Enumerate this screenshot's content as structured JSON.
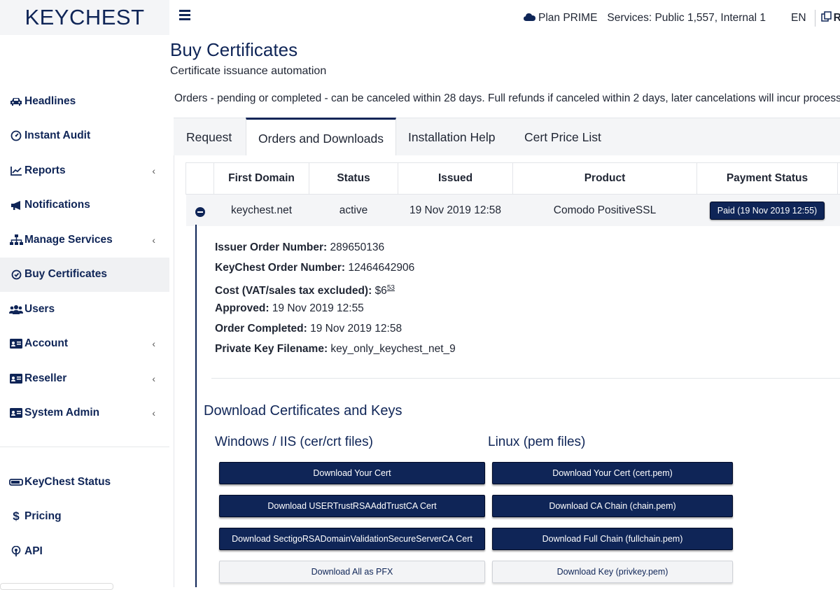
{
  "app": {
    "logo": "KEYCHEST"
  },
  "topbar": {
    "plan_label": "Plan PRIME",
    "services_label": "Services: Public 1,557, Internal 1",
    "language": "EN",
    "cut_label": "Re"
  },
  "sidebar": {
    "items": [
      {
        "label": "Headlines",
        "icon": "car-icon"
      },
      {
        "label": "Instant Audit",
        "icon": "gauge-icon"
      },
      {
        "label": "Reports",
        "icon": "chart-icon",
        "has_submenu": true
      },
      {
        "label": "Notifications",
        "icon": "megaphone-icon"
      },
      {
        "label": "Manage Services",
        "icon": "sitemap-icon",
        "has_submenu": true
      },
      {
        "label": "Buy Certificates",
        "icon": "badge-icon",
        "active": true
      },
      {
        "label": "Users",
        "icon": "users-icon"
      },
      {
        "label": "Account",
        "icon": "id-card-icon",
        "has_submenu": true
      },
      {
        "label": "Reseller",
        "icon": "id-card-icon",
        "has_submenu": true
      },
      {
        "label": "System Admin",
        "icon": "id-card-icon",
        "has_submenu": true
      }
    ],
    "secondary": [
      {
        "label": "KeyChest Status",
        "icon": "status-bar-icon"
      },
      {
        "label": "Pricing",
        "icon": "dollar-icon"
      },
      {
        "label": "API",
        "icon": "broadcast-icon"
      }
    ]
  },
  "page": {
    "title": "Buy Certificates",
    "subtitle": "Certificate issuance automation",
    "notice": "Orders - pending or completed - can be canceled within 28 days. Full refunds if canceled within 2 days, later cancelations will incur processing f"
  },
  "tabs": [
    {
      "label": "Request"
    },
    {
      "label": "Orders and Downloads",
      "active": true
    },
    {
      "label": "Installation Help"
    },
    {
      "label": "Cert Price List"
    }
  ],
  "orders_table": {
    "headers": [
      "",
      "First Domain",
      "Status",
      "Issued",
      "Product",
      "Payment Status"
    ],
    "rows": [
      {
        "first_domain": "keychest.net",
        "status": "active",
        "issued": "19 Nov 2019 12:58",
        "product": "Comodo PositiveSSL",
        "payment_status": "Paid (19 Nov 2019 12:55)"
      }
    ]
  },
  "order_details": {
    "issuer_order_label": "Issuer Order Number:",
    "issuer_order_value": "289650136",
    "keychest_order_label": "KeyChest Order Number:",
    "keychest_order_value": "12464642906",
    "cost_label": "Cost (VAT/sales tax excluded):",
    "cost_main": "$6",
    "cost_cents": "53",
    "approved_label": "Approved:",
    "approved_value": "19 Nov 2019 12:55",
    "completed_label": "Order Completed:",
    "completed_value": "19 Nov 2019 12:58",
    "private_key_label": "Private Key Filename:",
    "private_key_value": "key_only_keychest_net_9"
  },
  "downloads": {
    "title": "Download Certificates and Keys",
    "windows": {
      "title": "Windows / IIS (cer/crt files)",
      "buttons": [
        "Download Your Cert",
        "Download USERTrustRSAAddTrustCA Cert",
        "Download SectigoRSADomainValidationSecureServerCA Cert",
        "Download All as PFX"
      ]
    },
    "linux": {
      "title": "Linux (pem files)",
      "buttons": [
        "Download Your Cert (cert.pem)",
        "Download CA Chain (chain.pem)",
        "Download Full Chain (fullchain.pem)",
        "Download Key (privkey.pem)"
      ]
    }
  },
  "colors": {
    "brand": "#0f2557",
    "panel": "#f4f5f7"
  }
}
